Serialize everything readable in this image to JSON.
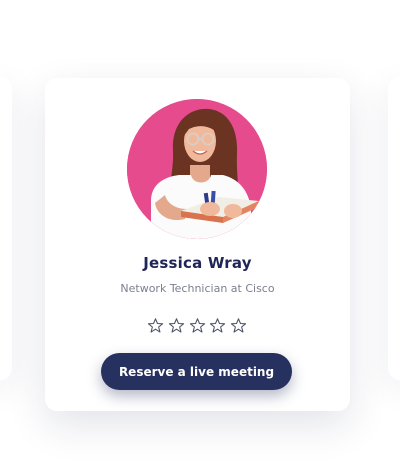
{
  "profile": {
    "name": "Jessica Wray",
    "title": "Network Technician at Cisco",
    "avatar_icon": "portrait-photo",
    "rating": 0,
    "rating_max": 5
  },
  "actions": {
    "reserve_label": "Reserve a live meeting"
  },
  "colors": {
    "button_bg": "#27315f",
    "name": "#1f2556",
    "subtitle": "#7b7f8f",
    "star_outline": "#4c5265",
    "avatar_bg": "#e64b8d"
  }
}
